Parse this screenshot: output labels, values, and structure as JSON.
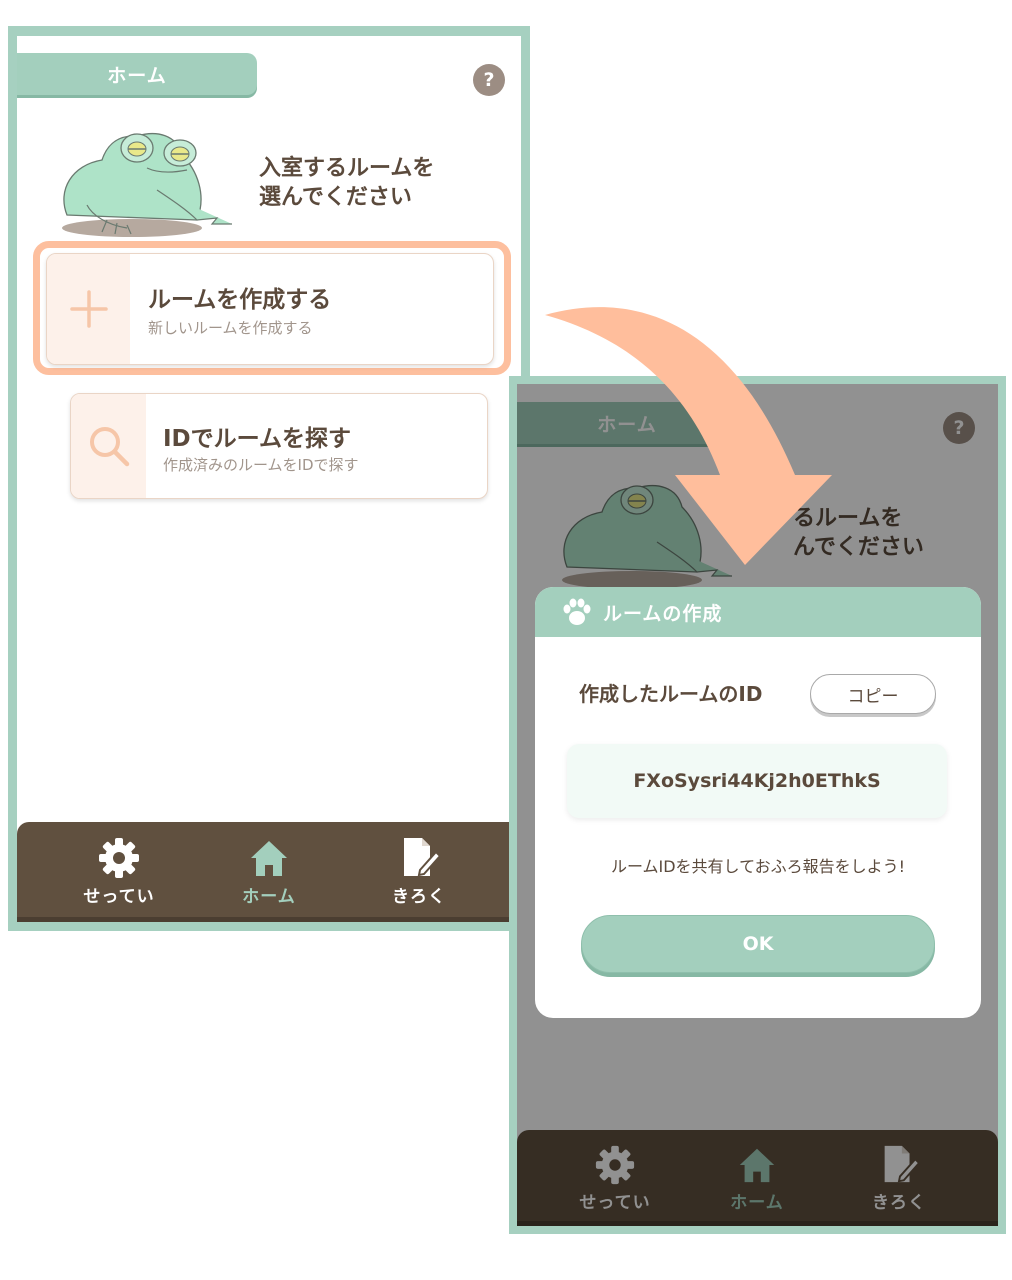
{
  "screen1": {
    "header_title": "ホーム",
    "help_label": "?",
    "intro_text": [
      "入室するルームを",
      "選んでください"
    ],
    "cards": [
      {
        "title": "ルームを作成する",
        "subtitle": "新しいルームを作成する",
        "icon": "plus-icon"
      },
      {
        "title": "IDでルームを探す",
        "subtitle": "作成済みのルームをIDで探す",
        "icon": "search-icon"
      }
    ],
    "tabs": [
      {
        "label": "せってい",
        "icon": "gear-icon"
      },
      {
        "label": "ホーム",
        "icon": "home-icon",
        "active": true
      },
      {
        "label": "きろく",
        "icon": "note-edit-icon"
      }
    ]
  },
  "screen2": {
    "header_title": "ホーム",
    "help_label": "?",
    "intro_text": [
      "るルームを",
      "んでください"
    ],
    "modal": {
      "title": "ルームの作成",
      "icon": "paw-icon",
      "id_label": "作成したルームのID",
      "copy_label": "コピー",
      "room_id": "FXoSysri44Kj2h0EThkS",
      "share_message": "ルームIDを共有しておふろ報告をしよう!",
      "ok_label": "OK"
    },
    "tabs": [
      {
        "label": "せってい",
        "icon": "gear-icon"
      },
      {
        "label": "ホーム",
        "icon": "home-icon",
        "active": true
      },
      {
        "label": "きろく",
        "icon": "note-edit-icon"
      }
    ]
  },
  "colors": {
    "mint": "#a3cfbd",
    "brown_tabbar": "#60503f",
    "text_brown": "#5b4a3c",
    "highlight_peach": "#fdbf9e",
    "arrow_peach": "#ffbe9c",
    "active_tab": "#a3cfbd"
  }
}
